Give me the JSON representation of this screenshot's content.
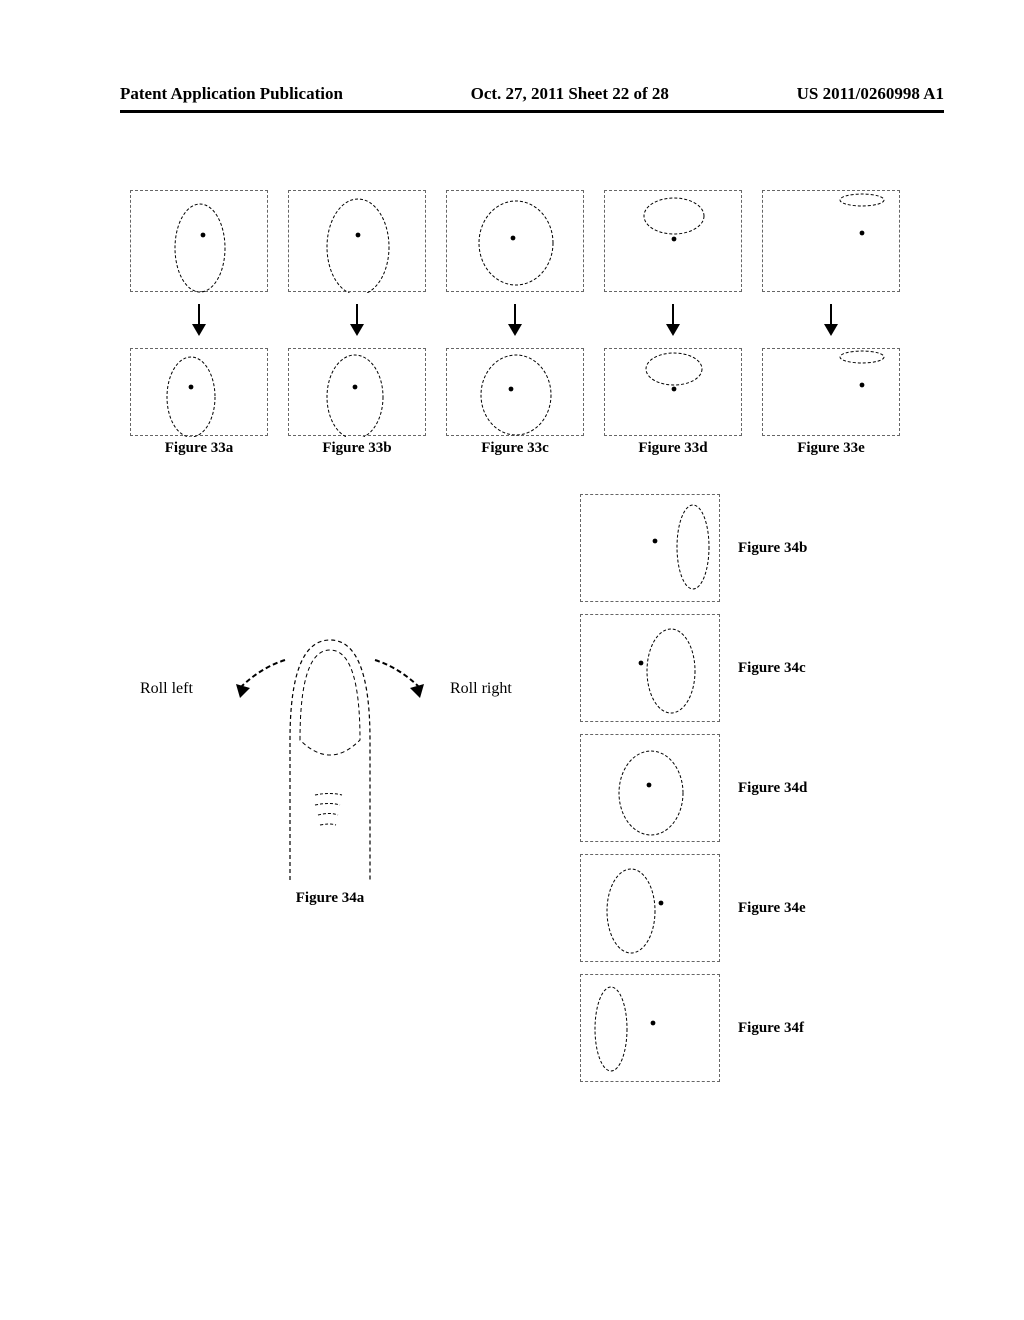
{
  "header": {
    "left": "Patent Application Publication",
    "center": "Oct. 27, 2011  Sheet 22 of 28",
    "right": "US 2011/0260998 A1"
  },
  "fig33_labels": [
    "Figure 33a",
    "Figure 33b",
    "Figure 33c",
    "Figure 33d",
    "Figure 33e"
  ],
  "fig34a": {
    "roll_left": "Roll left",
    "roll_right": "Roll right",
    "caption": "Figure 34a"
  },
  "fig34_col": [
    {
      "label": "Figure 34b"
    },
    {
      "label": "Figure 34c"
    },
    {
      "label": "Figure 34d"
    },
    {
      "label": "Figure 34e"
    },
    {
      "label": "Figure 34f"
    }
  ]
}
